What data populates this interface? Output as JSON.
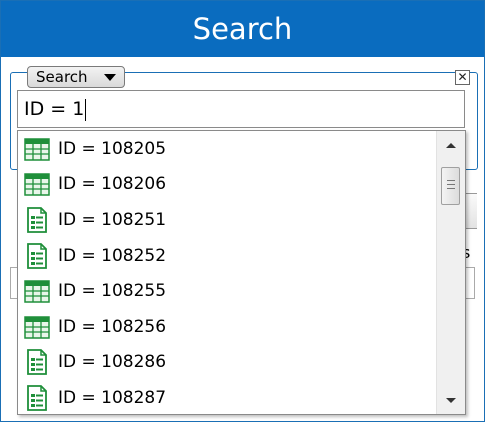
{
  "header": {
    "title": "Search"
  },
  "search_mode": {
    "selected": "Search"
  },
  "query": {
    "value": "ID = 1"
  },
  "background": {
    "partial_label": "s"
  },
  "results": [
    {
      "label": "ID = 108205",
      "icon": "green-grid-sheet-icon"
    },
    {
      "label": "ID = 108206",
      "icon": "green-grid-sheet-icon"
    },
    {
      "label": "ID = 108251",
      "icon": "green-form-document-icon"
    },
    {
      "label": "ID = 108252",
      "icon": "green-form-document-icon"
    },
    {
      "label": "ID = 108255",
      "icon": "green-grid-sheet-icon"
    },
    {
      "label": "ID = 108256",
      "icon": "green-grid-sheet-icon"
    },
    {
      "label": "ID = 108286",
      "icon": "green-form-document-icon"
    },
    {
      "label": "ID = 108287",
      "icon": "green-form-document-icon"
    }
  ],
  "colors": {
    "header_bg": "#0a6cbf",
    "icon_green": "#1f8f3a"
  }
}
